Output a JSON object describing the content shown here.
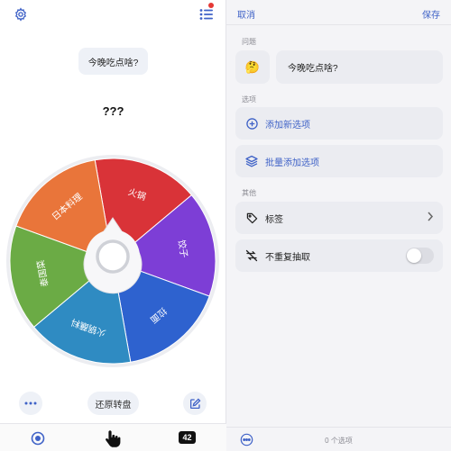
{
  "left": {
    "question": "今晚吃点啥?",
    "result": "???",
    "reset_label": "还原转盘",
    "count_badge": "42",
    "icons": {
      "settings": "gear-icon",
      "list": "list-icon",
      "more": "more-icon",
      "edit": "edit-icon",
      "tab_wheel": "wheel-icon",
      "tab_hand": "hand-pointer-icon"
    }
  },
  "wheel": {
    "segments": [
      {
        "label": "火锅",
        "color": "#d93338"
      },
      {
        "label": "饺子",
        "color": "#7d3ed6"
      },
      {
        "label": "拉面",
        "color": "#2e62cf"
      },
      {
        "label": "火锅蘸料",
        "color": "#2f8bc2"
      },
      {
        "label": "泰国菜",
        "color": "#6bab45"
      },
      {
        "label": "日本料理",
        "color": "#e9753a"
      }
    ]
  },
  "right": {
    "cancel": "取消",
    "save": "保存",
    "section_question": "问题",
    "question_emoji": "🤔",
    "question_text": "今晚吃点啥?",
    "section_options": "选项",
    "add_option": "添加新选项",
    "batch_add": "批量添加选项",
    "section_other": "其他",
    "tags": "标签",
    "no_repeat": "不重复抽取",
    "no_repeat_enabled": false,
    "footer_count": "0 个选项"
  },
  "colors": {
    "accent": "#3f62c7",
    "card_bg": "#ebecf1",
    "panel_bg": "#f4f4f7"
  }
}
